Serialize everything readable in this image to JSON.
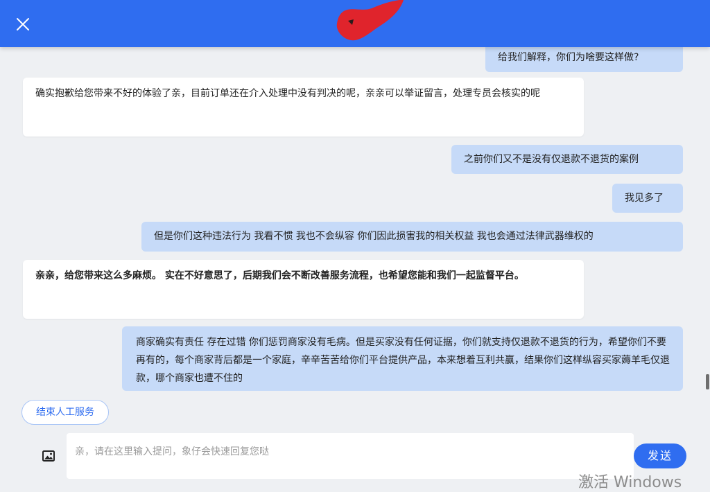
{
  "header": {
    "close_icon": "close-icon",
    "color": "#2f6df0"
  },
  "messages": [
    {
      "role": "user",
      "text": "给我们解释，你们为啥要这样做?"
    },
    {
      "role": "agent",
      "text": "确实抱歉给您带来不好的体验了亲，目前订单还在介入处理中没有判决的呢，亲亲可以举证留言，处理专员会核实的呢"
    },
    {
      "role": "user",
      "text": "之前你们又不是没有仅退款不退货的案例"
    },
    {
      "role": "user",
      "text": "我见多了"
    },
    {
      "role": "user",
      "text": "但是你们这种违法行为 我看不惯 我也不会纵容 你们因此损害我的相关权益 我也会通过法律武器维权的"
    },
    {
      "role": "agent",
      "text": "亲亲，给您带来这么多麻烦。 实在不好意思了，后期我们会不断改善服务流程，也希望您能和我们一起监督平台。"
    },
    {
      "role": "user",
      "text": "商家确实有责任 存在过错 你们惩罚商家没有毛病。但是买家没有任何证据，你们就支持仅退款不退货的行为，希望你们不要再有的，每个商家背后都是一个家庭，辛辛苦苦给你们平台提供产品，本来想着互利共赢，结果你们这样纵容买家薅羊毛仅退款，哪个商家也遭不住的"
    }
  ],
  "end_service_label": "结束人工服务",
  "composer": {
    "image_icon": "image-icon",
    "placeholder": "亲，请在这里输入提问，象仔会快速回复您哒",
    "send_label": "发送"
  },
  "watermark": "激活 Windows",
  "colors": {
    "user_bubble": "#c6daf8",
    "agent_bubble": "#ffffff",
    "accent": "#2f6df0",
    "background": "#eef0f3"
  }
}
